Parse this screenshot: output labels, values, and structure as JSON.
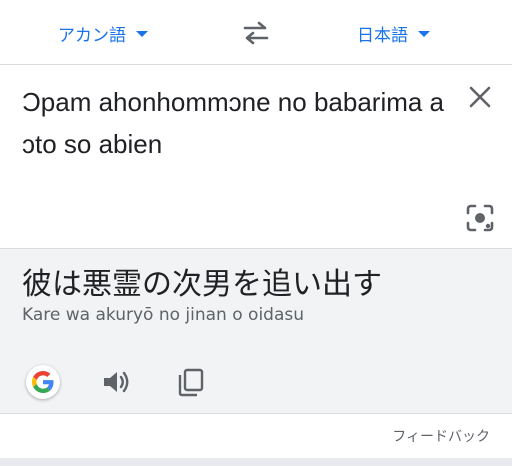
{
  "language_bar": {
    "source_language": "アカン語",
    "target_language": "日本語"
  },
  "source": {
    "text": "Ɔpam ahonhommɔne no babarima a ɔto so abien"
  },
  "result": {
    "translation": "彼は悪霊の次男を追い出す",
    "romanization": "Kare wa akuryō no jinan o oidasu"
  },
  "footer": {
    "feedback_label": "フィードバック"
  },
  "icons": {
    "swap": "swap-arrows-icon",
    "clear": "close-icon",
    "lens": "camera-lens-icon",
    "google": "google-logo-icon",
    "speaker": "speaker-icon",
    "copy": "copy-icon"
  },
  "colors": {
    "accent": "#1a73e8",
    "text": "#202124",
    "secondary_text": "#5f6368",
    "result_background": "#f1f3f4"
  }
}
